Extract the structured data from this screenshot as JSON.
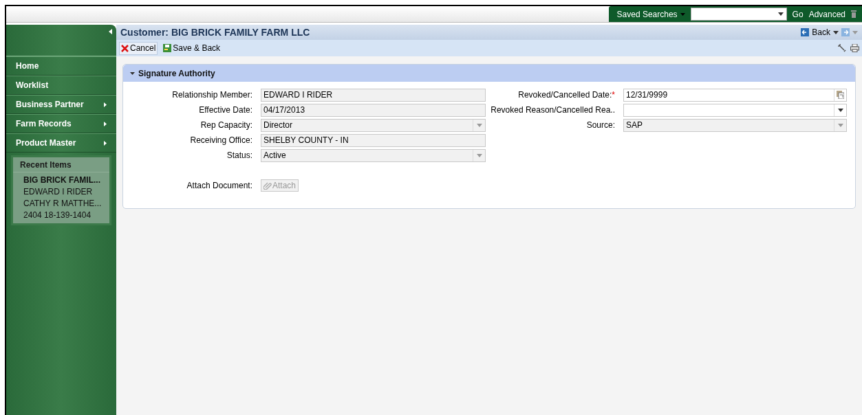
{
  "top_bar": {
    "saved_searches": "Saved Searches",
    "go": "Go",
    "advanced": "Advanced"
  },
  "sidebar": {
    "items": [
      {
        "label": "Home",
        "has_submenu": false
      },
      {
        "label": "Worklist",
        "has_submenu": false
      },
      {
        "label": "Business Partner",
        "has_submenu": true
      },
      {
        "label": "Farm Records",
        "has_submenu": true
      },
      {
        "label": "Product Master",
        "has_submenu": true
      }
    ],
    "recent": {
      "title": "Recent Items",
      "items": [
        "BIG BRICK FAMIL...",
        "EDWARD I RIDER",
        "CATHY R MATTHE...",
        "2404 18-139-1404"
      ]
    }
  },
  "header": {
    "title": "Customer: BIG BRICK FAMILY FARM LLC",
    "back": "Back"
  },
  "toolbar": [
    "Cancel",
    "Save & Back"
  ],
  "section": {
    "title": "Signature Authority",
    "expanded": true,
    "left_fields": [
      {
        "label": "Relationship Member:",
        "value": "EDWARD I RIDER",
        "kind": "text",
        "disabled": true
      },
      {
        "label": "Effective Date:",
        "value": "04/17/2013",
        "kind": "text",
        "disabled": true
      },
      {
        "label": "Rep Capacity:",
        "value": "Director",
        "kind": "select",
        "disabled": true
      },
      {
        "label": "Receiving Office:",
        "value": "SHELBY COUNTY - IN",
        "kind": "text",
        "disabled": true
      },
      {
        "label": "Status:",
        "value": "Active",
        "kind": "select",
        "disabled": true
      }
    ],
    "right_fields": [
      {
        "label": "Revoked/Cancelled Date:",
        "value": "12/31/9999",
        "kind": "date",
        "disabled": false,
        "required_mark": "*"
      },
      {
        "label": "Revoked Reason/Cancelled Rea..",
        "kind": "select",
        "disabled": false
      },
      {
        "label": "Source:",
        "value": "SAP",
        "kind": "select",
        "disabled": true
      }
    ],
    "attach": {
      "label": "Attach Document:",
      "button": "Attach",
      "disabled": true
    }
  }
}
